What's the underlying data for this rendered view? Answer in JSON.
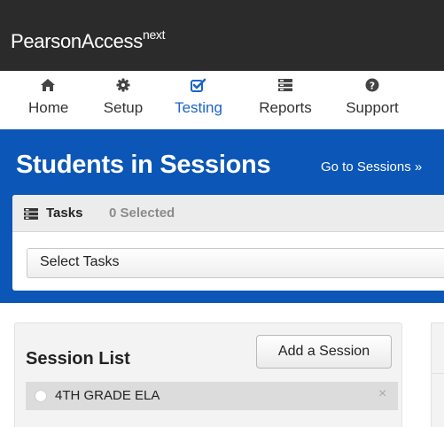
{
  "brand": {
    "name": "PearsonAccess",
    "suffix": "next"
  },
  "nav": {
    "items": [
      {
        "label": "Home",
        "icon": "home-icon"
      },
      {
        "label": "Setup",
        "icon": "gear-icon"
      },
      {
        "label": "Testing",
        "icon": "checkbox-icon",
        "active": true
      },
      {
        "label": "Reports",
        "icon": "reports-icon"
      },
      {
        "label": "Support",
        "icon": "question-icon"
      }
    ]
  },
  "page": {
    "title": "Students in Sessions",
    "goto_link": "Go to Sessions »"
  },
  "tasks": {
    "label": "Tasks",
    "selected_count": "0 Selected",
    "select_label": "Select Tasks"
  },
  "sessions": {
    "title": "Session List",
    "add_button": "Add a Session",
    "items": [
      {
        "label": "4TH GRADE ELA",
        "close_glyph": "×"
      }
    ]
  },
  "colors": {
    "brand_bar": "#2b2b2b",
    "accent_blue": "#0b56b6",
    "active_nav": "#1b64c8"
  }
}
